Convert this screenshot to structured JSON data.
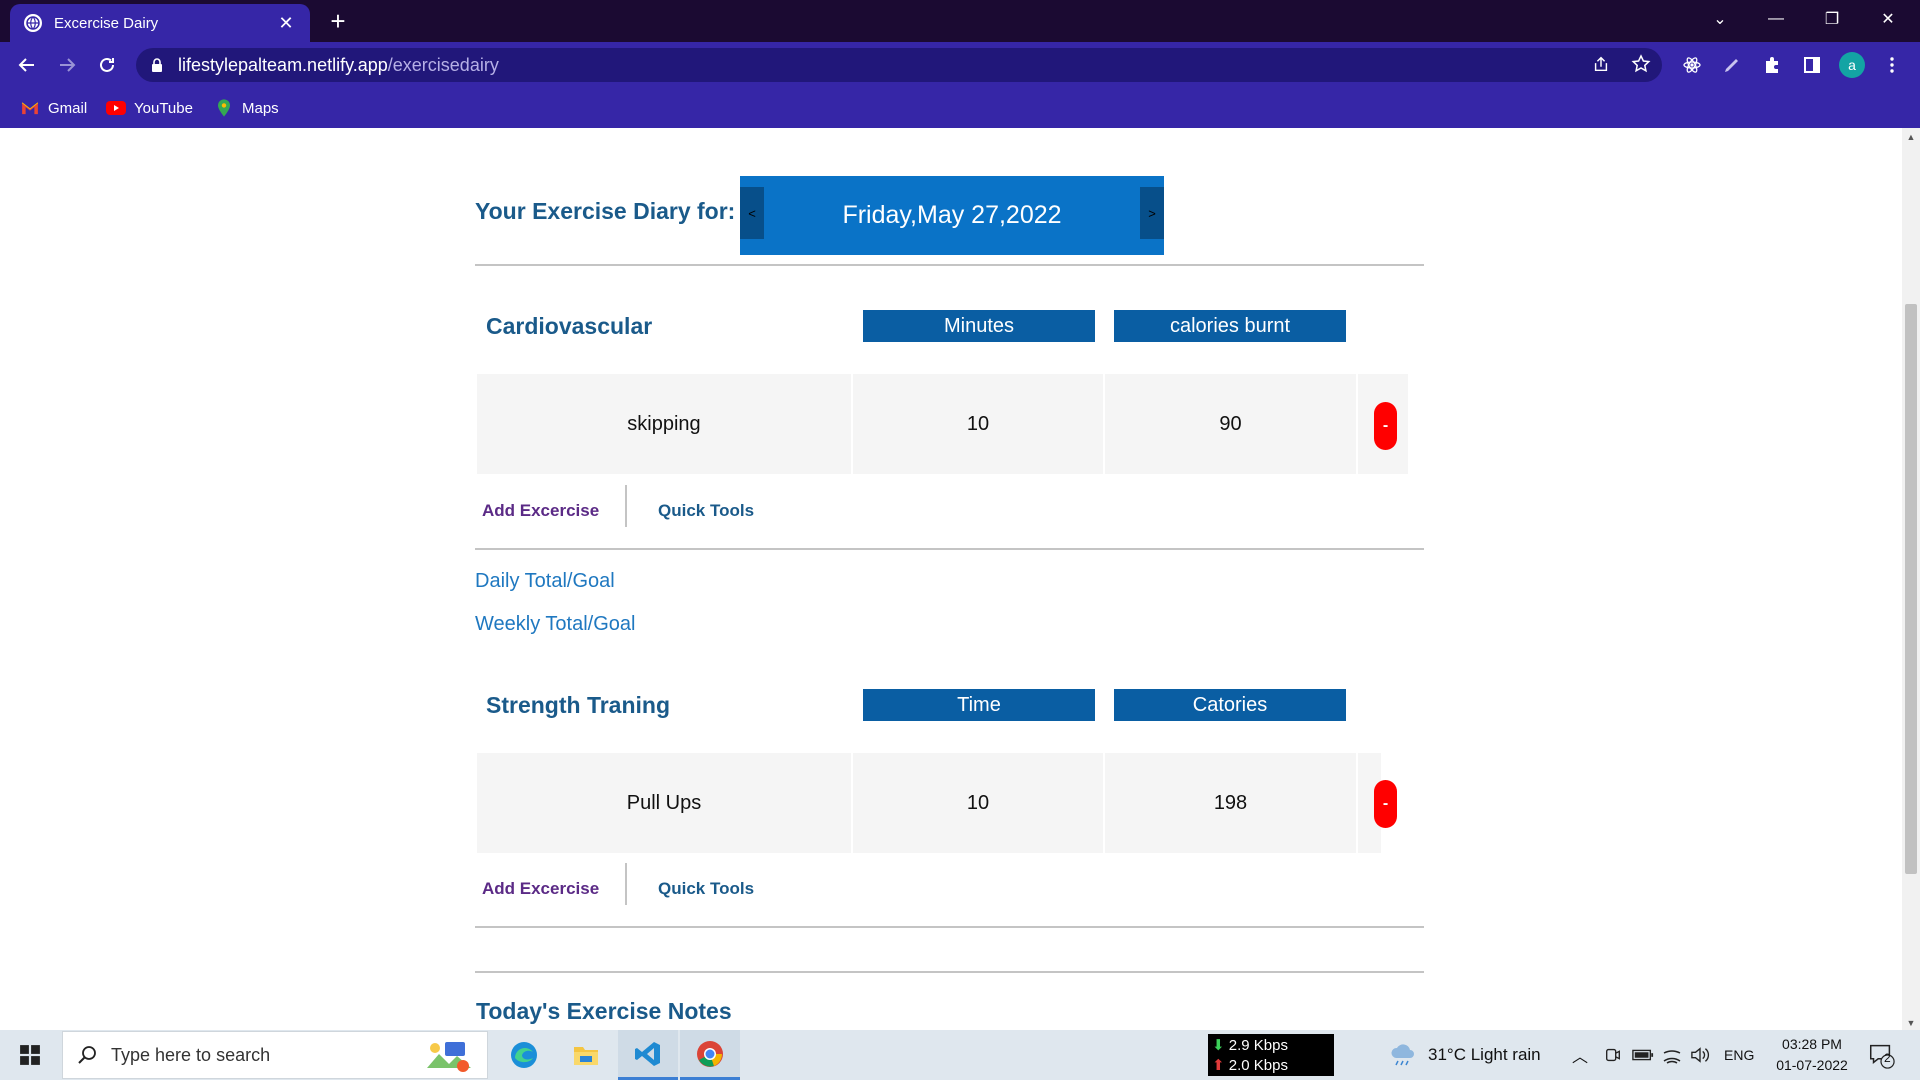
{
  "browser": {
    "tab_title": "Excercise Dairy",
    "url_host": "lifestylepalteam.netlify.app",
    "url_path": "/exercisedairy",
    "avatar_letter": "a",
    "bookmarks": [
      {
        "label": "Gmail",
        "icon": "gmail-icon"
      },
      {
        "label": "YouTube",
        "icon": "youtube-icon"
      },
      {
        "label": "Maps",
        "icon": "maps-icon"
      }
    ],
    "colors": {
      "tabbar": "#1b0a32",
      "toolbar": "#3626a7"
    }
  },
  "diary": {
    "title": "Your Exercise Diary for:",
    "date": "Friday,May 27,2022",
    "prev_label": "<",
    "next_label": ">"
  },
  "cardio": {
    "title": "Cardiovascular",
    "col1": "Minutes",
    "col2": "calories burnt",
    "rows": [
      {
        "name": "skipping",
        "value1": "10",
        "value2": "90"
      }
    ],
    "delete_label": "-",
    "add_label": "Add Excercise",
    "tools_label": "Quick Tools"
  },
  "totals": {
    "daily": "Daily Total/Goal",
    "weekly": "Weekly Total/Goal"
  },
  "strength": {
    "title": "Strength Traning",
    "col1": "Time",
    "col2": "Catories",
    "rows": [
      {
        "name": "Pull Ups",
        "value1": "10",
        "value2": "198"
      }
    ],
    "delete_label": "-",
    "add_label": "Add Excercise",
    "tools_label": "Quick Tools"
  },
  "notes": {
    "title": "Today's Exercise Notes"
  },
  "taskbar": {
    "search_placeholder": "Type here to search",
    "net_down": "2.9 Kbps",
    "net_up": "2.0 Kbps",
    "weather": "31°C  Light rain",
    "lang": "ENG",
    "time": "03:28 PM",
    "date": "01-07-2022",
    "notif_count": "2"
  },
  "accent": {
    "brand_blue": "#0a5ea3",
    "title_blue": "#1a5a8a",
    "delete_red": "#ff0000"
  }
}
